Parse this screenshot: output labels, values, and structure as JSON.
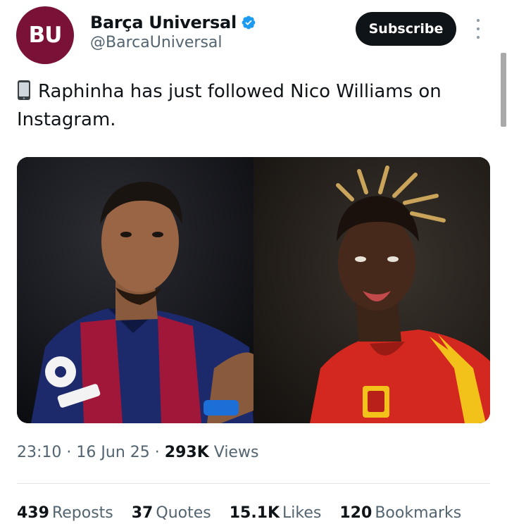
{
  "author": {
    "avatar_text": "BU",
    "display_name": "Barça Universal",
    "handle": "@BarcaUniversal",
    "verified": true,
    "avatar_color": "#7a1238",
    "verified_color": "#1d9bf0"
  },
  "header": {
    "subscribe_label": "Subscribe"
  },
  "tweet": {
    "text": "Raphinha has just followed Nico Williams on Instagram.",
    "emoji_icon": "mobile-phone-icon"
  },
  "media": {
    "left_photo": "raphinha-barcelona-kit-photo",
    "right_photo": "nico-williams-spain-kit-photo"
  },
  "meta": {
    "time": "23:10",
    "separator": "·",
    "date": "16 Jun 25",
    "views_count": "293K",
    "views_label": "Views"
  },
  "stats": [
    {
      "count": "439",
      "label": "Reposts"
    },
    {
      "count": "37",
      "label": "Quotes"
    },
    {
      "count": "15.1K",
      "label": "Likes"
    },
    {
      "count": "120",
      "label": "Bookmarks"
    }
  ]
}
